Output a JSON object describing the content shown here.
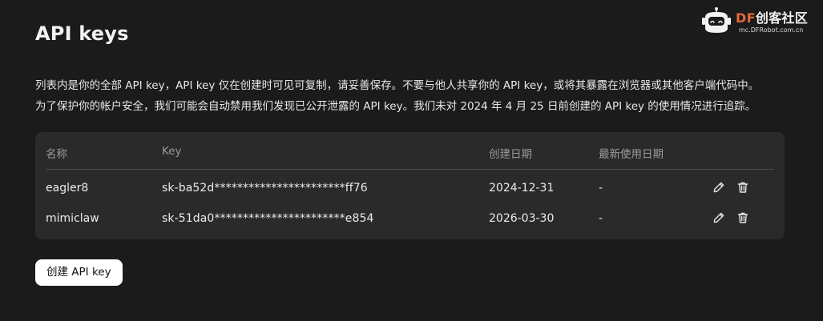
{
  "page": {
    "title": "API keys",
    "description_lines": [
      "列表内是你的全部 API key，API key 仅在创建时可见可复制，请妥善保存。不要与他人共享你的 API key，或将其暴露在浏览器或其他客户端代码中。",
      "为了保护你的帐户安全，我们可能会自动禁用我们发现已公开泄露的 API key。我们未对 2024 年 4 月 25 日前创建的 API key 的使用情况进行追踪。"
    ]
  },
  "table": {
    "headers": {
      "name": "名称",
      "key": "Key",
      "created": "创建日期",
      "last_used": "最新使用日期"
    },
    "rows": [
      {
        "name": "eagler8",
        "key": "sk-ba52d***********************ff76",
        "created": "2024-12-31",
        "last_used": "-"
      },
      {
        "name": "mimiclaw",
        "key": "sk-51da0***********************e854",
        "created": "2026-03-30",
        "last_used": "-"
      }
    ],
    "row_actions": [
      "edit-icon",
      "trash-icon"
    ]
  },
  "actions": {
    "create_label": "创建 API key"
  },
  "watermark": {
    "brand_latin": "DF",
    "brand_cn": "创客社区",
    "url": "mc.DFRobot.com.cn",
    "brand_color": "#e8673b"
  }
}
